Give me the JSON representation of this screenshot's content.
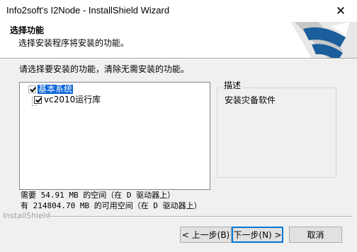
{
  "window": {
    "title": "Info2soft's I2Node - InstallShield Wizard",
    "close_glyph": "✕"
  },
  "header": {
    "title": "选择功能",
    "subtitle": "选择安装程序将安装的功能。"
  },
  "content": {
    "instruction": "请选择要安装的功能，清除无需安装的功能。",
    "features": [
      {
        "label": "基本系统",
        "checked": true,
        "selected": true,
        "disabled": true
      },
      {
        "label": "vc2010运行库",
        "checked": true,
        "selected": false,
        "disabled": false
      }
    ],
    "description_legend": "描述",
    "description_text": "安装灾备软件",
    "space_required": "需要 54.91 MB 的空间（在 D 驱动器上）",
    "space_available": "有 214804.70 MB 的可用空间（在 D 驱动器上）"
  },
  "footer": {
    "brand": "InstallShield",
    "back_label": "< 上一步(B)",
    "next_label": "下一步(N) >",
    "cancel_label": "取消"
  },
  "colors": {
    "accent": "#0078d7",
    "logo_blue": "#1b5e9c",
    "selection": "#0a64d8"
  }
}
